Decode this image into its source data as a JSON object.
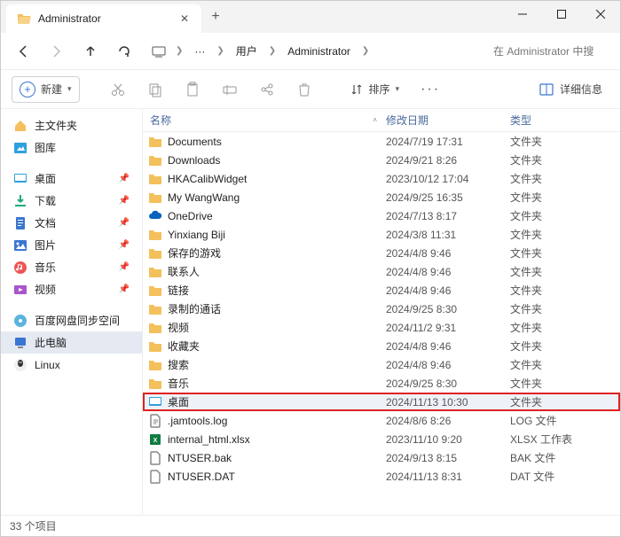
{
  "window": {
    "tab_title": "Administrator"
  },
  "breadcrumb": {
    "overflow": "···",
    "items": [
      "用户",
      "Administrator"
    ]
  },
  "search": {
    "placeholder": "在 Administrator 中搜"
  },
  "toolbar": {
    "new_label": "新建",
    "sort_label": "排序",
    "details_label": "详细信息"
  },
  "sidebar": {
    "items": [
      {
        "icon": "home",
        "label": "主文件夹",
        "pinned": false
      },
      {
        "icon": "gallery",
        "label": "图库",
        "pinned": false
      },
      {
        "spacer": true
      },
      {
        "icon": "desktop",
        "label": "桌面",
        "pinned": true
      },
      {
        "icon": "download",
        "label": "下载",
        "pinned": true
      },
      {
        "icon": "doc",
        "label": "文档",
        "pinned": true
      },
      {
        "icon": "pic",
        "label": "图片",
        "pinned": true
      },
      {
        "icon": "music",
        "label": "音乐",
        "pinned": true
      },
      {
        "icon": "video",
        "label": "视频",
        "pinned": true
      },
      {
        "spacer": true
      },
      {
        "icon": "disk",
        "label": "百度网盘同步空间",
        "pinned": false
      },
      {
        "icon": "pc",
        "label": "此电脑",
        "pinned": false,
        "selected": true
      },
      {
        "icon": "linux",
        "label": "Linux",
        "pinned": false
      }
    ]
  },
  "columns": {
    "name": "名称",
    "date": "修改日期",
    "type": "类型"
  },
  "files": [
    {
      "icon": "folder",
      "name": "Documents",
      "date": "2024/7/19 17:31",
      "type": "文件夹"
    },
    {
      "icon": "folder",
      "name": "Downloads",
      "date": "2024/9/21 8:26",
      "type": "文件夹"
    },
    {
      "icon": "folder",
      "name": "HKACalibWidget",
      "date": "2023/10/12 17:04",
      "type": "文件夹"
    },
    {
      "icon": "folder",
      "name": "My WangWang",
      "date": "2024/9/25 16:35",
      "type": "文件夹"
    },
    {
      "icon": "cloud",
      "name": "OneDrive",
      "date": "2024/7/13 8:17",
      "type": "文件夹"
    },
    {
      "icon": "folder",
      "name": "Yinxiang Biji",
      "date": "2024/3/8 11:31",
      "type": "文件夹"
    },
    {
      "icon": "folder",
      "name": "保存的游戏",
      "date": "2024/4/8 9:46",
      "type": "文件夹"
    },
    {
      "icon": "folder",
      "name": "联系人",
      "date": "2024/4/8 9:46",
      "type": "文件夹"
    },
    {
      "icon": "folder",
      "name": "链接",
      "date": "2024/4/8 9:46",
      "type": "文件夹"
    },
    {
      "icon": "folder",
      "name": "录制的通话",
      "date": "2024/9/25 8:30",
      "type": "文件夹"
    },
    {
      "icon": "folder",
      "name": "视频",
      "date": "2024/11/2 9:31",
      "type": "文件夹"
    },
    {
      "icon": "folder",
      "name": "收藏夹",
      "date": "2024/4/8 9:46",
      "type": "文件夹"
    },
    {
      "icon": "folder",
      "name": "搜索",
      "date": "2024/4/8 9:46",
      "type": "文件夹"
    },
    {
      "icon": "folder",
      "name": "音乐",
      "date": "2024/9/25 8:30",
      "type": "文件夹"
    },
    {
      "icon": "desktop",
      "name": "桌面",
      "date": "2024/11/13 10:30",
      "type": "文件夹",
      "highlighted": true
    },
    {
      "icon": "log",
      "name": ".jamtools.log",
      "date": "2024/8/6 8:26",
      "type": "LOG 文件"
    },
    {
      "icon": "xlsx",
      "name": "internal_html.xlsx",
      "date": "2023/11/10 9:20",
      "type": "XLSX 工作表"
    },
    {
      "icon": "file",
      "name": "NTUSER.bak",
      "date": "2024/9/13 8:15",
      "type": "BAK 文件"
    },
    {
      "icon": "file",
      "name": "NTUSER.DAT",
      "date": "2024/11/13 8:31",
      "type": "DAT 文件"
    }
  ],
  "status": {
    "count_label": "33 个项目"
  }
}
